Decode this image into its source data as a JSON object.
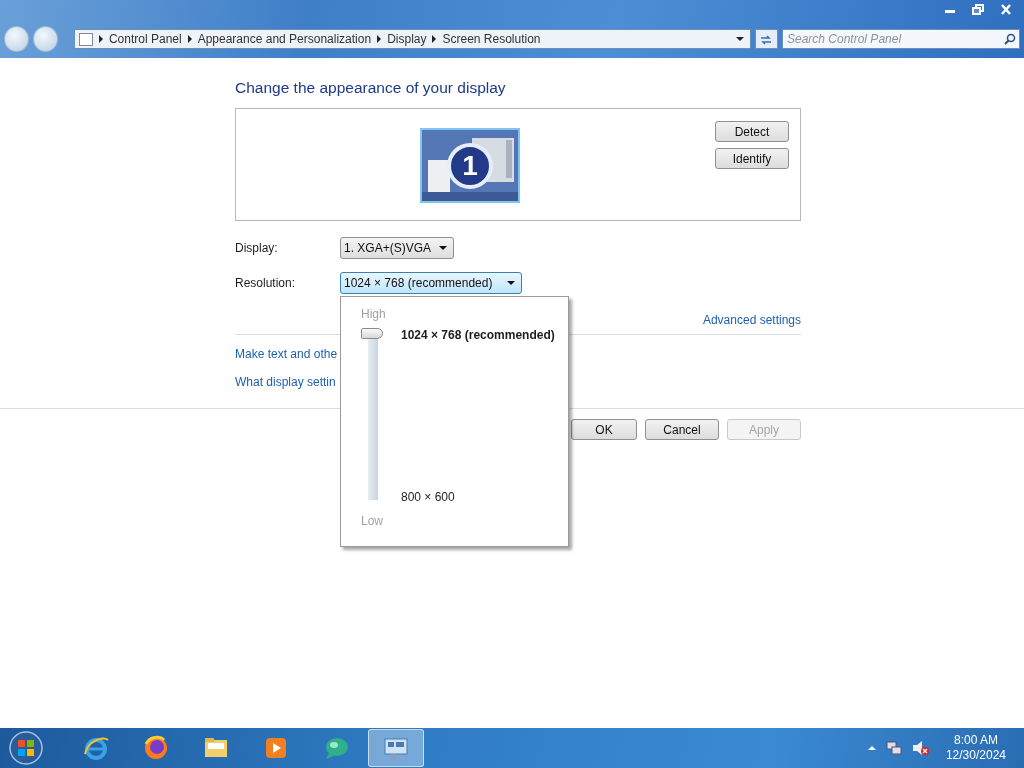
{
  "address_bar": {
    "breadcrumb": [
      "Control Panel",
      "Appearance and Personalization",
      "Display",
      "Screen Resolution"
    ]
  },
  "search": {
    "placeholder": "Search Control Panel"
  },
  "heading": "Change the appearance of your display",
  "monitor": {
    "label": "1",
    "selected": true
  },
  "monitor_buttons": [
    "Detect",
    "Identify"
  ],
  "display": {
    "label": "Display:",
    "value": "1. XGA+(S)VGA"
  },
  "resolution": {
    "label": "Resolution:",
    "value": "1024 × 768 (recommended)",
    "expanded": true
  },
  "resolution_popup": {
    "high": "High",
    "low": "Low",
    "level": 1,
    "options": [
      {
        "label": "1024 × 768 (recommended)",
        "selected": true
      },
      {
        "label": "800 × 600",
        "selected": false
      }
    ]
  },
  "advanced_link": "Advanced settings",
  "links": [
    "Make text and othe",
    "What display settin"
  ],
  "buttons": [
    {
      "label": "OK",
      "disabled": false
    },
    {
      "label": "Cancel",
      "disabled": false
    },
    {
      "label": "Apply",
      "disabled": true
    }
  ],
  "taskbar": {
    "apps": [
      {
        "selected": false
      },
      {
        "selected": false
      },
      {
        "selected": false
      },
      {
        "selected": false
      },
      {
        "selected": false
      },
      {
        "selected": true
      }
    ],
    "time": "8:00 AM",
    "date": "12/30/2024"
  }
}
